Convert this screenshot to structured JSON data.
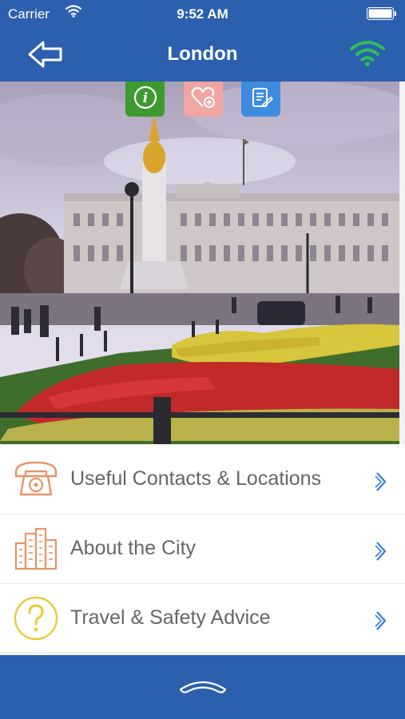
{
  "status_bar": {
    "carrier": "Carrier",
    "time": "9:52 AM"
  },
  "nav": {
    "title": "London"
  },
  "quick_actions": [
    {
      "icon": "info-icon",
      "color": "#3d9a2e"
    },
    {
      "icon": "heart-plus-icon",
      "color": "#f0a5a0"
    },
    {
      "icon": "notes-icon",
      "color": "#3e8ce0"
    }
  ],
  "menu": {
    "items": [
      {
        "label": "Useful Contacts & Locations",
        "icon": "telephone-icon"
      },
      {
        "label": "About the City",
        "icon": "city-buildings-icon"
      },
      {
        "label": "Travel & Safety Advice",
        "icon": "question-circle-icon"
      }
    ]
  },
  "colors": {
    "brand_blue": "#2c5fae",
    "wifi_green": "#2ebd59",
    "chevron_blue": "#3a82d6"
  }
}
